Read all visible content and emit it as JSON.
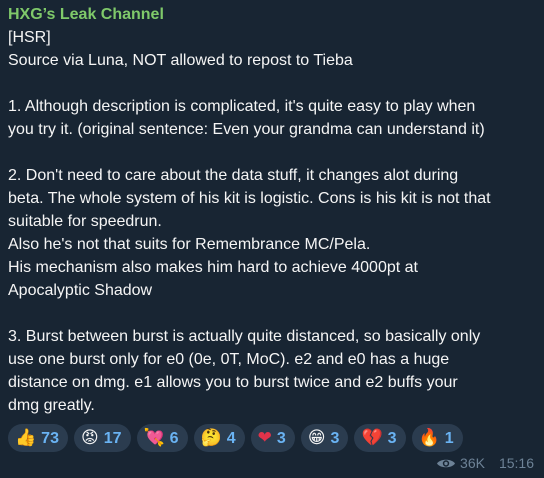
{
  "message": {
    "channel_name": "HXG’s Leak Channel",
    "lines": [
      "[HSR]",
      "Source via Luna, NOT allowed to repost to Tieba",
      "",
      "1. Although description is complicated, it's quite easy to play when",
      "you try it. (original sentence: Even your grandma can understand it)",
      "",
      "2. Don't need to care about the data stuff, it changes alot during",
      "beta. The whole system of his kit is logistic. Cons is his kit is not that",
      "suitable for speedrun.",
      "Also he's not that suits for Remembrance MC/Pela.",
      "His mechanism also makes him hard to achieve 4000pt at",
      "Apocalyptic Shadow",
      "",
      "3. Burst between burst is actually quite distanced, so basically only",
      "use one burst only for e0 (0e, 0T, MoC). e2 and e0 has a huge",
      "distance on dmg. e1 allows you to burst twice and e2 buffs your",
      "dmg greatly."
    ]
  },
  "reactions": [
    {
      "icon": "thumbs-up-icon",
      "emoji": "👍",
      "count": "73"
    },
    {
      "icon": "angry-face-icon",
      "emoji": "😡",
      "count": "17"
    },
    {
      "icon": "heart-arrow-icon",
      "emoji": "💘",
      "count": "6"
    },
    {
      "icon": "thinking-face-icon",
      "emoji": "🤔",
      "count": "4"
    },
    {
      "icon": "red-heart-icon",
      "emoji": "❤",
      "count": "3"
    },
    {
      "icon": "grinning-face-icon",
      "emoji": "😁",
      "count": "3"
    },
    {
      "icon": "burning-heart-icon",
      "emoji": "💔",
      "count": "3"
    },
    {
      "icon": "fire-icon",
      "emoji": "🔥",
      "count": "1"
    }
  ],
  "meta": {
    "views": "36K",
    "time": "15:16"
  },
  "colors": {
    "channel_name": "#7fc96a",
    "reaction_count": "#6ab3f3",
    "bubble_bg": "#182533"
  }
}
